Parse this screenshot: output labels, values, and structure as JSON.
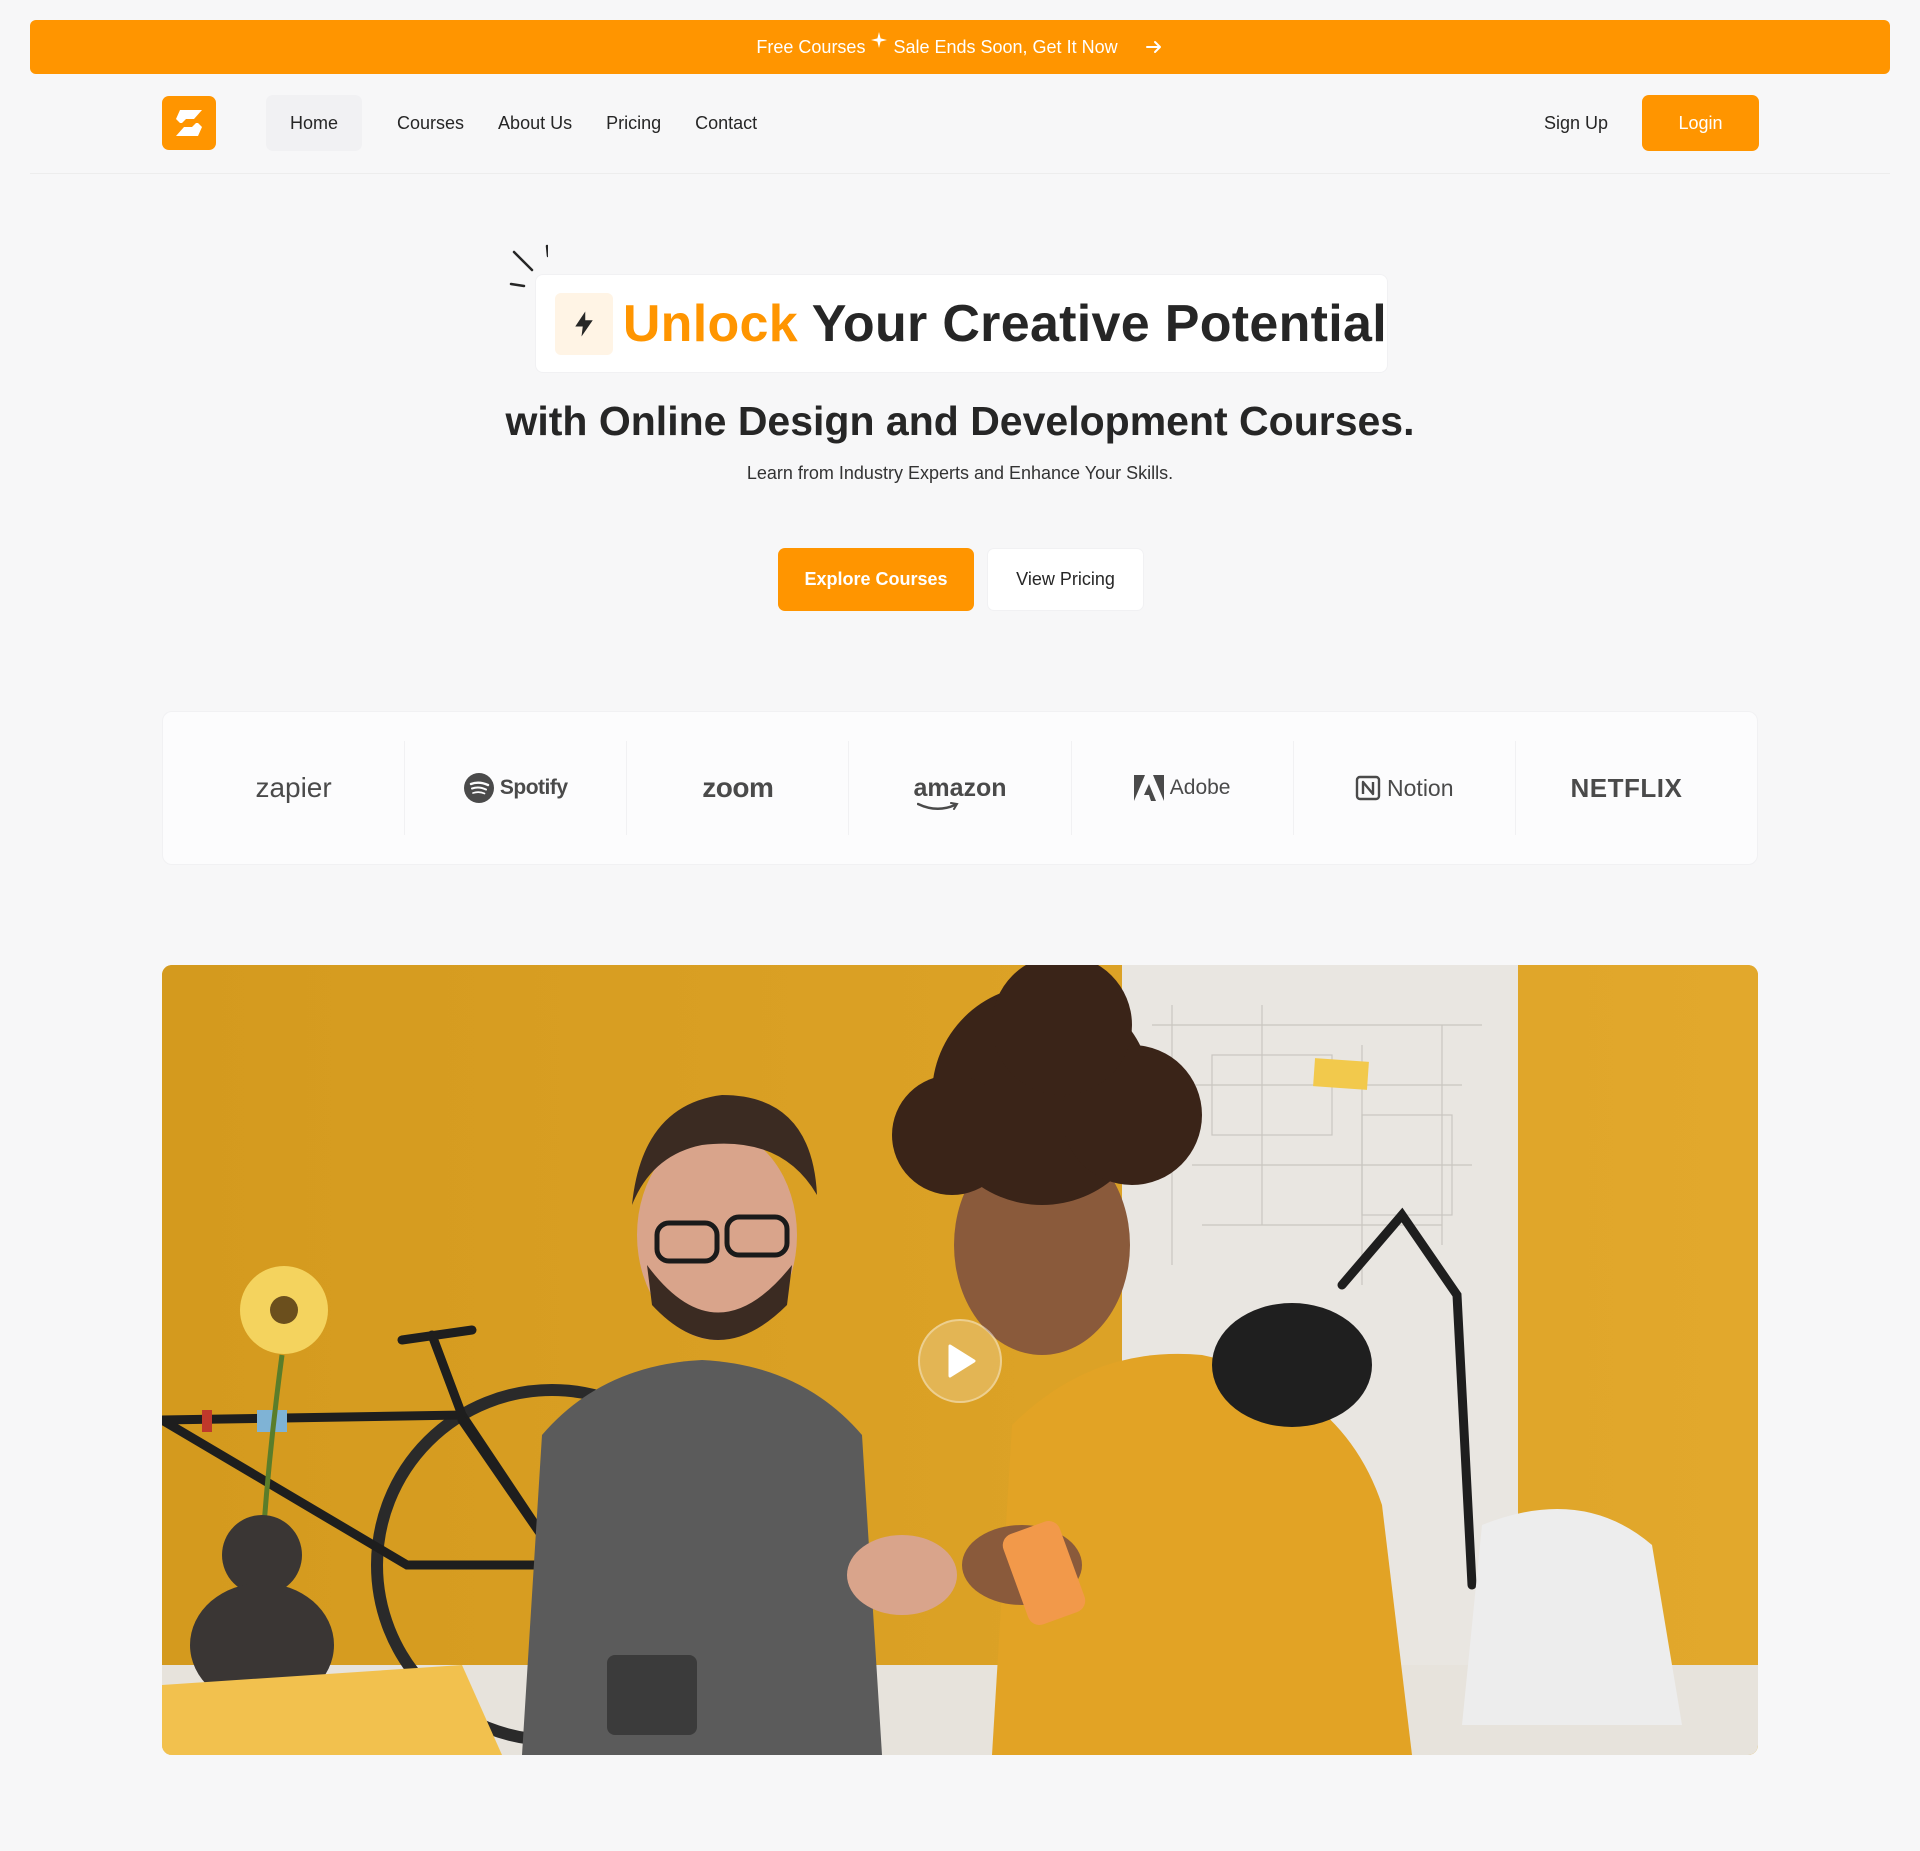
{
  "announcement": {
    "text_before": "Free Courses",
    "text_after": "Sale Ends Soon, Get It Now"
  },
  "header": {
    "nav": [
      "Home",
      "Courses",
      "About Us",
      "Pricing",
      "Contact"
    ],
    "signup": "Sign Up",
    "login": "Login"
  },
  "hero": {
    "headline_accent": "Unlock",
    "headline_rest": "Your Creative Potential",
    "subheadline": "with Online Design and Development Courses.",
    "tagline": "Learn from Industry Experts and Enhance Your Skills.",
    "primary_button": "Explore Courses",
    "secondary_button": "View Pricing"
  },
  "logos": [
    "zapier",
    "Spotify",
    "zoom",
    "amazon",
    "Adobe",
    "Notion",
    "NETFLIX"
  ],
  "colors": {
    "accent": "#FF9500",
    "background": "#F7F7F8",
    "text": "#262626",
    "accent_soft": "#FFF4E5"
  },
  "icons": {
    "logo": "brand-s-icon",
    "announcement_arrow": "arrow-right-icon",
    "headline": "lightning-bolt-icon",
    "video": "play-icon"
  }
}
